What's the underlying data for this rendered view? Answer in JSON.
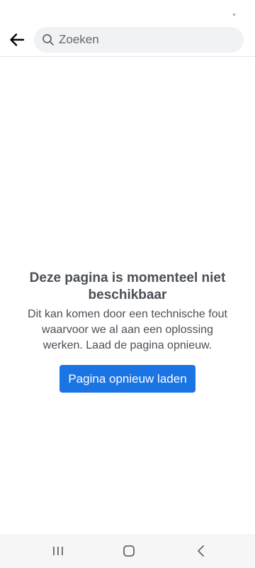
{
  "search": {
    "placeholder": "Zoeken"
  },
  "error": {
    "title": "Deze pagina is momenteel niet beschikbaar",
    "message": "Dit kan komen door een technische fout waarvoor we al aan een oplossing werken. Laad de pagina opnieuw.",
    "reload_label": "Pagina opnieuw laden"
  },
  "icons": {
    "back": "back-arrow-icon",
    "search": "search-icon",
    "nav_recents": "recents-icon",
    "nav_home": "home-icon",
    "nav_back": "nav-back-icon"
  },
  "colors": {
    "accent": "#1b74e4",
    "text": "#4b4f56",
    "search_bg": "#f0f2f5",
    "nav_bg": "#f6f6f6"
  }
}
